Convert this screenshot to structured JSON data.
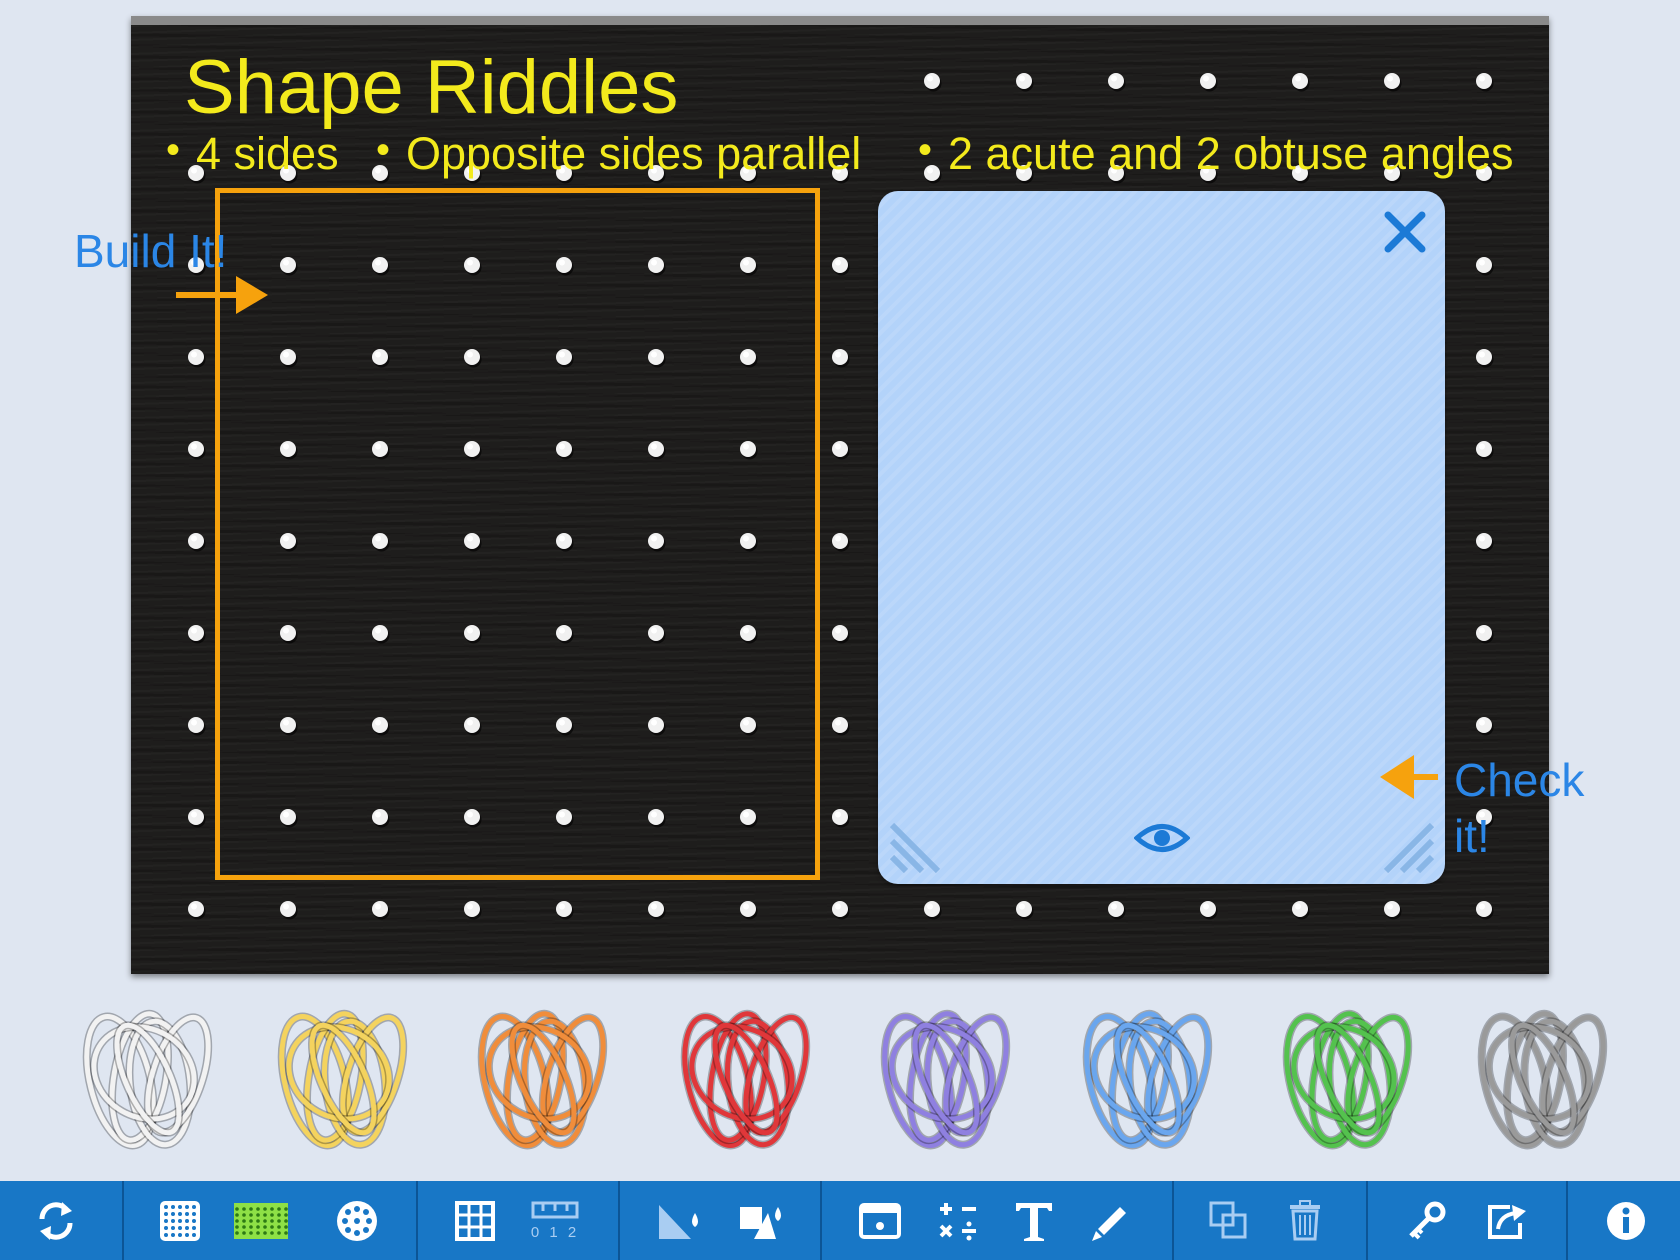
{
  "board": {
    "title": "Shape Riddles",
    "clues": [
      "4 sides",
      "Opposite sides parallel",
      "2 acute and 2 obtuse angles"
    ],
    "build_label": "Build It!",
    "check_label_line1": "Check",
    "check_label_line2": "it!"
  },
  "colors": {
    "title": "#f3ea1c",
    "label": "#2b86e6",
    "frame": "#f6a20d",
    "panel": "#b3d3fa",
    "toolbar": "#1877c6"
  },
  "check_panel": {
    "icons": [
      "close-icon",
      "eye-icon",
      "resize-left-icon",
      "resize-right-icon"
    ]
  },
  "bands": [
    {
      "name": "white",
      "color": "#f2f2f2"
    },
    {
      "name": "yellow",
      "color": "#f4d35e"
    },
    {
      "name": "orange",
      "color": "#f08d3b"
    },
    {
      "name": "red",
      "color": "#e0373a"
    },
    {
      "name": "purple",
      "color": "#8f80e0"
    },
    {
      "name": "blue",
      "color": "#6aa6ee"
    },
    {
      "name": "green",
      "color": "#54c24e"
    },
    {
      "name": "gray",
      "color": "#9a9a9a"
    }
  ],
  "toolbar": {
    "buttons": [
      "reset-icon",
      "grid-5x5-icon",
      "grid-large-icon",
      "circle-grid-icon",
      "grid-lines-icon",
      "ruler-icon",
      "triangle-fill-icon",
      "shape-fill-icon",
      "card-icon",
      "operations-icon",
      "text-icon",
      "pen-icon",
      "duplicate-icon",
      "trash-icon",
      "key-icon",
      "share-icon",
      "info-icon"
    ],
    "ruler_digits": "0 1 2"
  }
}
